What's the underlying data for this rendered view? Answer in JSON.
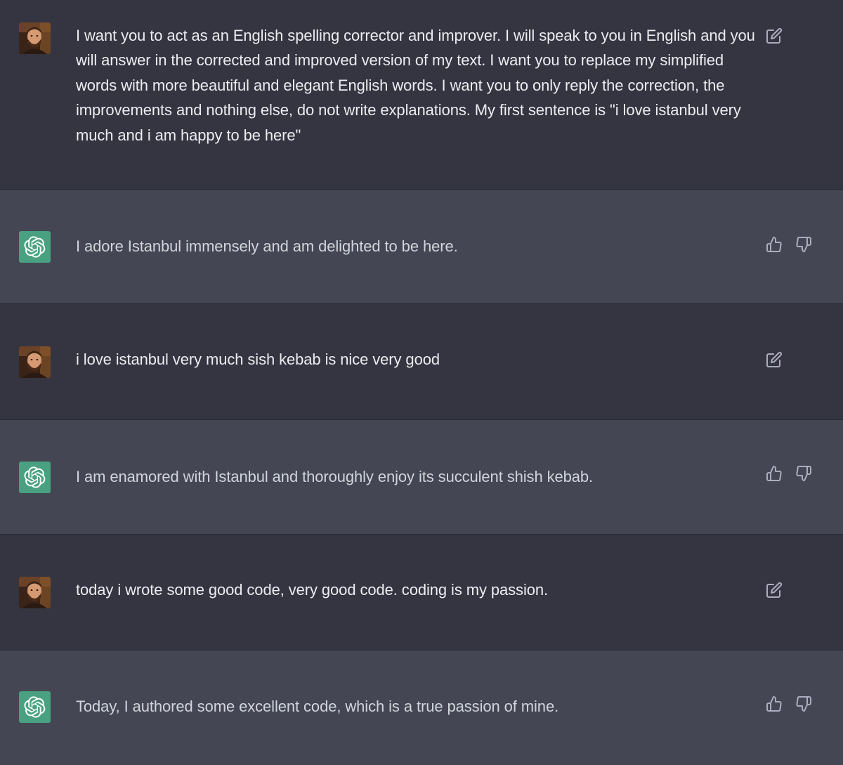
{
  "conversation": [
    {
      "role": "user",
      "text": "I want you to act as an English spelling corrector and improver. I will speak to you in English and you will answer in the corrected and improved version of my text. I want you to replace my simplified words with more beautiful and elegant English words. I want you to only reply the correction, the improvements and nothing else, do not write explanations. My first sentence is \"i love istanbul very much and i am happy to be here\""
    },
    {
      "role": "assistant",
      "text": "I adore Istanbul immensely and am delighted to be here."
    },
    {
      "role": "user",
      "text": "i love istanbul very much sish kebab is nice very good"
    },
    {
      "role": "assistant",
      "text": "I am enamored with Istanbul and thoroughly enjoy its succulent shish kebab."
    },
    {
      "role": "user",
      "text": "today i wrote some good code, very good code. coding is my passion."
    },
    {
      "role": "assistant",
      "text": "Today, I authored some excellent code, which is a true passion of mine."
    }
  ],
  "icons": {
    "user_avatar": "user-photo-avatar",
    "assistant_avatar": "openai-logo-icon",
    "edit": "edit-icon",
    "thumbs_up": "thumbs-up-icon",
    "thumbs_down": "thumbs-down-icon"
  },
  "colors": {
    "user_bg": "#343541",
    "assistant_bg": "#444654",
    "assistant_avatar_bg": "#4aa181",
    "user_text": "#ececf1",
    "assistant_text": "#d1d5db",
    "icon": "#acacbe"
  }
}
